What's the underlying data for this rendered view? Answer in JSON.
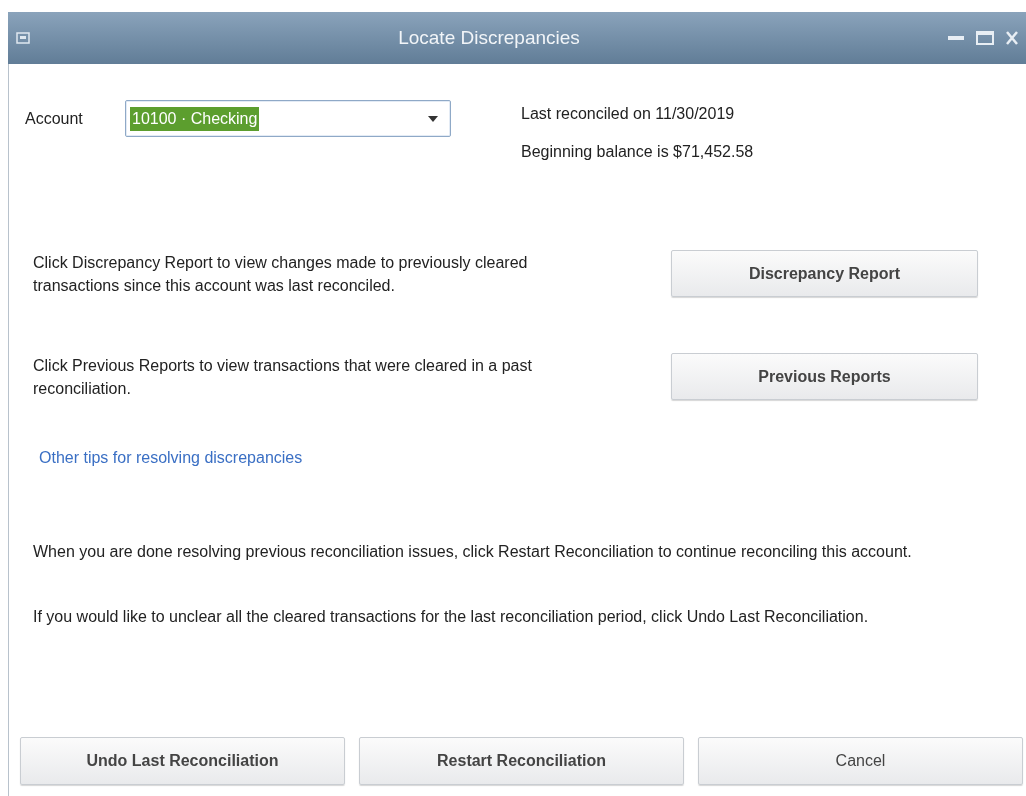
{
  "window": {
    "title": "Locate Discrepancies"
  },
  "account": {
    "label": "Account",
    "value": "10100 · Checking"
  },
  "info": [
    "Last reconciled on 11/30/2019",
    "Beginning balance is $71,452.58"
  ],
  "sections": [
    {
      "text": "Click Discrepancy Report to view changes made to previously cleared transactions since this account was last reconciled.",
      "button": "Discrepancy Report"
    },
    {
      "text": "Click Previous Reports to view transactions that were cleared in a past reconciliation.",
      "button": "Previous Reports"
    }
  ],
  "tips_link": "Other tips for resolving discrepancies",
  "notes": [
    "When you are done resolving previous reconciliation issues, click Restart Reconciliation to continue reconciling this account.",
    "If you would like to unclear all the cleared transactions for the last reconciliation period, click Undo Last Reconciliation."
  ],
  "buttons": [
    "Undo Last Reconciliation",
    "Restart Reconciliation",
    "Cancel"
  ]
}
